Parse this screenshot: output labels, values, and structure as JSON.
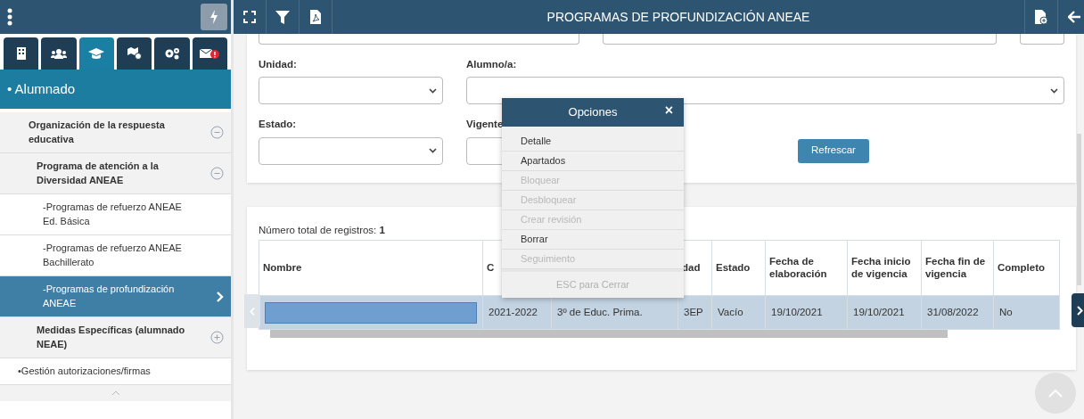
{
  "sidebar": {
    "tabs": [
      {
        "kind": "building",
        "selected": false
      },
      {
        "kind": "users",
        "selected": false
      },
      {
        "kind": "cap",
        "selected": true
      },
      {
        "kind": "map",
        "selected": false
      },
      {
        "kind": "gears",
        "selected": false
      },
      {
        "kind": "mail",
        "selected": false
      }
    ],
    "section": "• Alumnado",
    "tree": [
      {
        "label": "Organización de la respuesta educativa",
        "expanded": true,
        "children": [
          {
            "label": "Programa de atención a la Diversidad ANEAE",
            "expanded": true,
            "children": [
              {
                "label": "-Programas de refuerzo ANEAE Ed. Básica",
                "selected": false
              },
              {
                "label": "-Programas de refuerzo ANEAE Bachillerato",
                "selected": false
              },
              {
                "label": "-Programas de profundización ANEAE",
                "selected": true
              }
            ]
          },
          {
            "label": "Medidas Específicas (alumnado NEAE)",
            "expanded": false
          }
        ]
      }
    ],
    "footer_item": "•Gestión autorizaciones/firmas"
  },
  "toolbar": {
    "title": "PROGRAMAS DE PROFUNDIZACIÓN ANEAE"
  },
  "filters": {
    "unidad": {
      "label": "Unidad:"
    },
    "alumno": {
      "label": "Alumno/a:"
    },
    "estado": {
      "label": "Estado:"
    },
    "vigente": {
      "label": "Vigente"
    },
    "refresh": "Refrescar"
  },
  "results": {
    "total_label": "Número total de registros: ",
    "total": "1",
    "columns": [
      "Nombre",
      "C",
      "",
      "dad",
      "Estado",
      "Fecha de elaboración",
      "Fecha inicio de vigencia",
      "Fecha fin de vigencia",
      "Completo"
    ],
    "rows": [
      {
        "selected": true,
        "name_redacted": true,
        "cells": [
          "",
          "2021-2022",
          "3º de Educ. Prima.",
          "3EP",
          "Vacío",
          "19/10/2021",
          "19/10/2021",
          "31/08/2022",
          "No"
        ]
      }
    ]
  },
  "popup": {
    "title": "Opciones",
    "close": "×",
    "items": [
      {
        "label": "Detalle",
        "disabled": false
      },
      {
        "label": "Apartados",
        "disabled": false
      },
      {
        "label": "Bloquear",
        "disabled": true
      },
      {
        "label": "Desbloquear",
        "disabled": true
      },
      {
        "label": "Crear revisión",
        "disabled": true
      },
      {
        "label": "Borrar",
        "disabled": false
      },
      {
        "label": "Seguimiento",
        "disabled": true
      }
    ],
    "footer": "ESC para Cerrar"
  }
}
